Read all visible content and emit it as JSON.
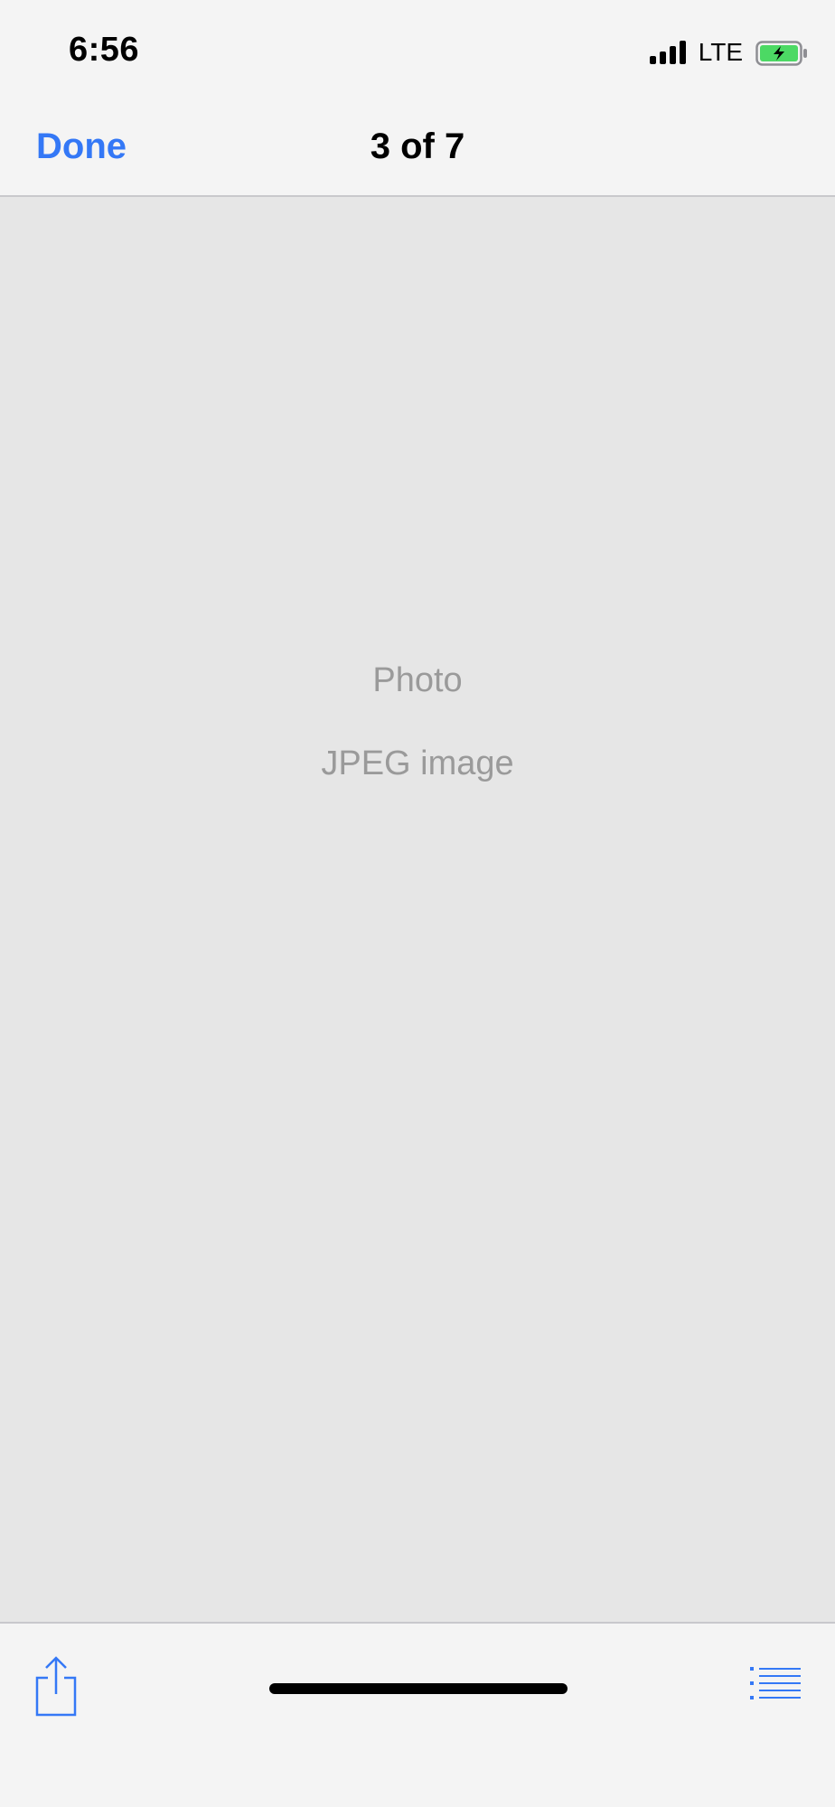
{
  "status_bar": {
    "time": "6:56",
    "carrier": "LTE",
    "signal_icon": "cellular-signal-icon",
    "battery_icon": "battery-charging-icon",
    "battery_color": "#4cd964"
  },
  "nav_bar": {
    "done_label": "Done",
    "title": "3 of 7"
  },
  "preview": {
    "name": "Photo",
    "type": "JPEG image"
  },
  "toolbar": {
    "share_icon": "share-icon",
    "list_icon": "list-icon"
  },
  "colors": {
    "accent": "#3478f6",
    "content_bg": "#e6e6e6",
    "bar_bg": "#f4f4f4",
    "placeholder_text": "#9a9a9a"
  }
}
